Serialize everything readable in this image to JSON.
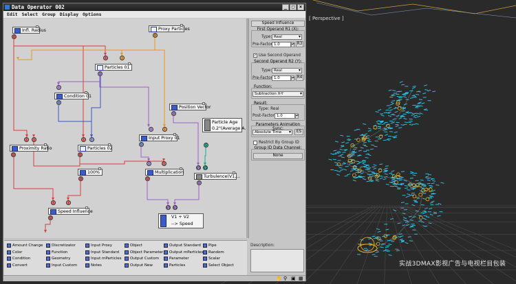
{
  "window": {
    "title": "Data Operator 002",
    "menu": [
      "Edit",
      "Select",
      "Group",
      "Display",
      "Options"
    ]
  },
  "viewport": {
    "label": "[ Perspective ]",
    "watermark": "实战3DMAX影视广告与电视栏目包装"
  },
  "nodes": {
    "infl_radius": "Infl. Radius",
    "proxy_particles": "Proxy Particles",
    "particles01": "Particles 01",
    "condition01": "Condition 01",
    "position_vector": "Position Vector",
    "particle_age_title": "Particle Age",
    "particle_age_sub": "0.2\"(Average A...",
    "input_proxy01": "Input Proxy 01",
    "proximity_ratio": "Proximity Ratio",
    "particles02": "Particles 02",
    "const_100": "100%",
    "multiplication": "Multiplication",
    "turbulence": "Turbulence(V1,...",
    "speed_influence": "Speed Influence",
    "output_title": "V1 + V2",
    "output_sub": "--> Speed"
  },
  "port_labels": {
    "o": "O",
    "i": "I",
    "v1": "V1",
    "v2": "V2",
    "s": "S"
  },
  "panel": {
    "title": "Speed Influence",
    "first_operand_group": "First Operand R1 (X):",
    "type_label": "Type:",
    "type1_value": "Real",
    "prefactor_label": "Pre-Factor:",
    "prefactor1_value": "1.0",
    "r3_btn": "R3",
    "use_second_label": "Use Second Operand",
    "second_operand_group": "Second Operand R2 (Y):",
    "type2_value": "Real",
    "prefactor2_value": "1.0",
    "r4_btn": "R4",
    "function_group": "Function:",
    "function_value": "Subtraction X-Y",
    "result_group": "Result:",
    "result_type": "Type: Real",
    "postfactor_label": "Post-Factor:",
    "postfactor_value": "1.0",
    "sync_group": "Parameters Animation Sync:",
    "sync_value": "Absolute Time",
    "es_btn": "ES",
    "restrict_label": "Restrict By Group ID",
    "group_id_group": "Group ID Data Channel:",
    "none_btn": "None",
    "description_label": "Description:"
  },
  "depot": [
    [
      "Amount Change",
      "Color",
      "Condition",
      "Convert"
    ],
    [
      "Discretizator",
      "Function",
      "Geometry",
      "Input Custom"
    ],
    [
      "Input Proxy",
      "Input Standard",
      "Input mParticles",
      "Notes"
    ],
    [
      "Object",
      "Object Parameter",
      "Output Custom",
      "Output New"
    ],
    [
      "Output Standard",
      "Output mParticles",
      "Parameter",
      "Particles"
    ],
    [
      "Pipe",
      "Random",
      "Scalar",
      "Select Object"
    ]
  ],
  "colors": {
    "red_wire": "#d93a3a",
    "orange_wire": "#e8961e",
    "purple_wire": "#9d5ec9",
    "blue_wire": "#3a55c8",
    "teal_wire": "#18a98c",
    "particle": "#35c8f0",
    "marker": "#f0b424"
  }
}
